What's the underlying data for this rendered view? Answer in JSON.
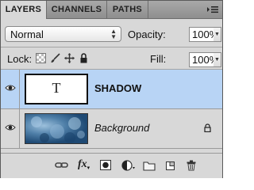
{
  "tabs": [
    {
      "label": "LAYERS",
      "active": true
    },
    {
      "label": "CHANNELS",
      "active": false
    },
    {
      "label": "PATHS",
      "active": false
    }
  ],
  "blend_mode": {
    "value": "Normal"
  },
  "opacity": {
    "label": "Opacity:",
    "value": "100%"
  },
  "lock": {
    "label": "Lock:",
    "icons": [
      "lock-transparent-pixels-icon",
      "lock-image-pixels-icon",
      "lock-position-icon",
      "lock-all-icon"
    ]
  },
  "fill": {
    "label": "Fill:",
    "value": "100%"
  },
  "layers": [
    {
      "name": "SHADOW",
      "thumb_text": "T",
      "selected": true,
      "locked": false
    },
    {
      "name": "Background",
      "selected": false,
      "locked": true
    }
  ],
  "bottom_icons": [
    "link-layers-icon",
    "layer-style-icon",
    "layer-mask-icon",
    "adjustment-layer-icon",
    "new-group-icon",
    "new-layer-icon",
    "delete-layer-icon"
  ],
  "colors": {
    "selected_row": "#b8d4f5",
    "panel_bg": "#d8d8d8",
    "tab_bar": "#999999"
  }
}
